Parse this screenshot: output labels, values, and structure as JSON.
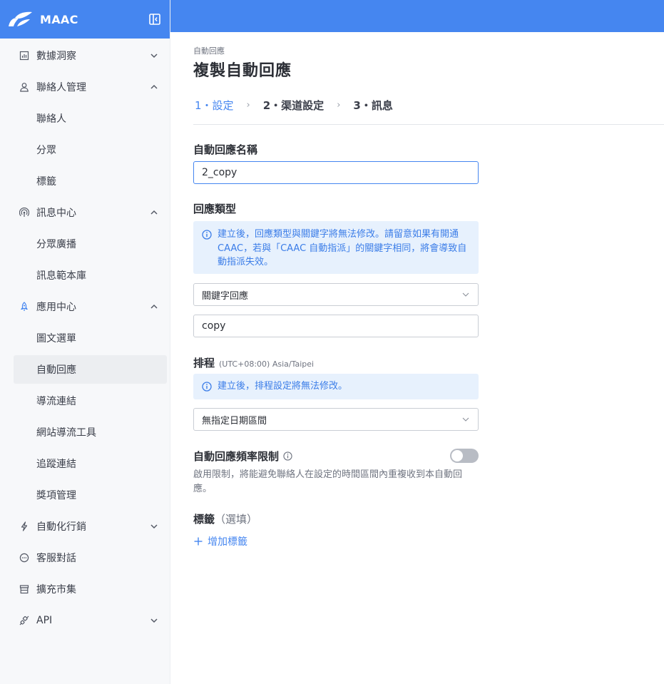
{
  "sidebar": {
    "brand": "MAAC",
    "items": [
      {
        "label": "數據洞察"
      },
      {
        "label": "聯絡人管理",
        "children": [
          "聯絡人",
          "分眾",
          "標籤"
        ]
      },
      {
        "label": "訊息中心",
        "children": [
          "分眾廣播",
          "訊息範本庫"
        ]
      },
      {
        "label": "應用中心",
        "children": [
          "圖文選單",
          "自動回應",
          "導流連結",
          "網站導流工具",
          "追蹤連結",
          "獎項管理"
        ]
      },
      {
        "label": "自動化行銷"
      },
      {
        "label": "客服對話"
      },
      {
        "label": "擴充市集"
      },
      {
        "label": "API"
      }
    ]
  },
  "breadcrumb": "自動回應",
  "page_title": "複製自動回應",
  "steps": [
    "1・設定",
    "2・渠道設定",
    "3・訊息"
  ],
  "form": {
    "name_label": "自動回應名稱",
    "name_value": "2_copy",
    "type_label": "回應類型",
    "type_notice": "建立後，回應類型與關鍵字將無法修改。請留意如果有開通 CAAC，若與「CAAC 自動指派」的關鍵字相同，將會導致自動指派失效。",
    "type_value": "關鍵字回應",
    "keyword_value": "copy",
    "schedule_label": "排程",
    "schedule_tz": "(UTC+08:00) Asia/Taipei",
    "schedule_notice": "建立後，排程設定將無法修改。",
    "schedule_value": "無指定日期區間",
    "freq_label": "自動回應頻率限制",
    "freq_desc": "啟用限制，將能避免聯絡人在設定的時間區間內重複收到本自動回應。",
    "tag_label": "標籤",
    "tag_optional": "（選填）",
    "add_tag": "增加標籤"
  },
  "colors": {
    "primary": "#4586f0",
    "alert_bg": "#e7f1fd",
    "sidebar_bg": "#f7f8fa"
  },
  "icons": [
    "chart-icon",
    "user-icon",
    "broadcast-icon",
    "rocket-icon",
    "lightning-icon",
    "chat-icon",
    "store-icon",
    "api-icon",
    "info-icon",
    "chevron-down-icon",
    "plus-icon"
  ]
}
